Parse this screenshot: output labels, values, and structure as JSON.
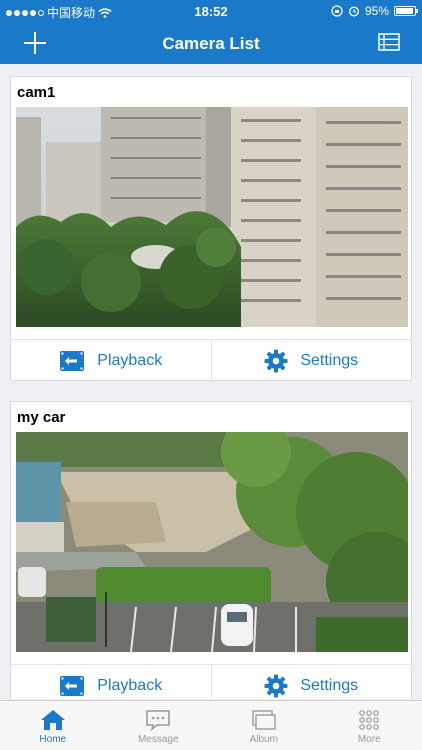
{
  "status_bar": {
    "carrier": "中国移动",
    "time": "18:52",
    "battery": "95%"
  },
  "nav": {
    "title": "Camera List"
  },
  "cameras": [
    {
      "name": "cam1",
      "playback_label": "Playback",
      "settings_label": "Settings"
    },
    {
      "name": "my car",
      "playback_label": "Playback",
      "settings_label": "Settings"
    }
  ],
  "tabs": [
    {
      "label": "Home",
      "icon": "home-icon",
      "active": true
    },
    {
      "label": "Message",
      "icon": "message-icon",
      "active": false
    },
    {
      "label": "Album",
      "icon": "album-icon",
      "active": false
    },
    {
      "label": "More",
      "icon": "more-grid-icon",
      "active": false
    }
  ],
  "colors": {
    "accent": "#1a7ac9",
    "background": "#efeff4",
    "tab_inactive": "#9a9a9f"
  }
}
